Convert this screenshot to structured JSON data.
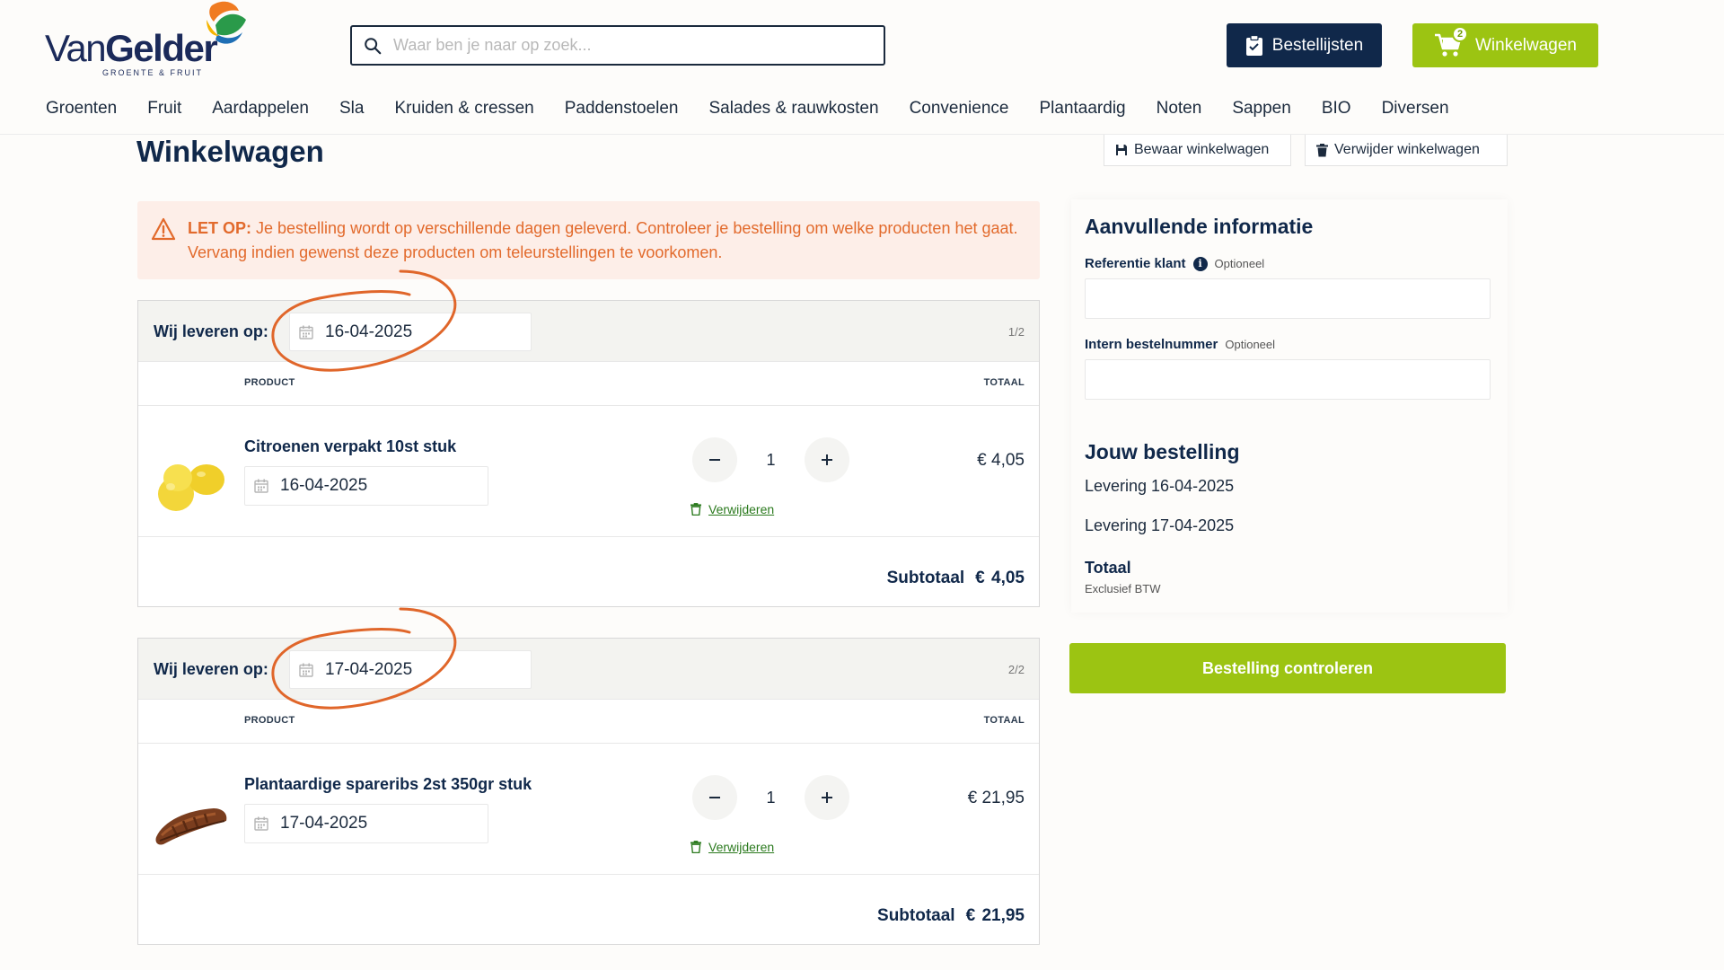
{
  "brand": {
    "name_light": "Van",
    "name_bold": "Gelder",
    "tagline": "GROENTE & FRUIT"
  },
  "search": {
    "placeholder": "Waar ben je naar op zoek..."
  },
  "header": {
    "lists_label": "Bestellijsten",
    "cart_label": "Winkelwagen",
    "cart_count": "2",
    "accent_green": "#9cc412",
    "accent_navy": "#10284a"
  },
  "nav": [
    "Groenten",
    "Fruit",
    "Aardappelen",
    "Sla",
    "Kruiden & cressen",
    "Paddenstoelen",
    "Salades & rauwkosten",
    "Convenience",
    "Plantaardig",
    "Noten",
    "Sappen",
    "BIO",
    "Diversen"
  ],
  "page": {
    "title": "Winkelwagen",
    "save_label": "Bewaar winkelwagen",
    "delete_label": "Verwijder winkelwagen"
  },
  "warning": {
    "lead": "LET OP:",
    "text": " Je bestelling wordt op verschillende dagen geleverd. Controleer je bestelling om welke producten het gaat. Vervang indien gewenst deze producten om teleurstellingen te voorkomen.",
    "color": "#e26a2c"
  },
  "deliveries": [
    {
      "label": "Wij leveren op:",
      "date": "16-04-2025",
      "page": "1/2",
      "col_product": "PRODUCT",
      "col_total": "TOTAAL",
      "product": {
        "name": "Citroenen verpakt 10st stuk",
        "date": "16-04-2025",
        "qty": "1",
        "price": "€ 4,05",
        "remove": "Verwijderen",
        "image": "lemons"
      },
      "subtotal_label": "Subtotaal",
      "subtotal_value": "€ 4,05"
    },
    {
      "label": "Wij leveren op:",
      "date": "17-04-2025",
      "page": "2/2",
      "col_product": "PRODUCT",
      "col_total": "TOTAAL",
      "product": {
        "name": "Plantaardige spareribs 2st 350gr stuk",
        "date": "17-04-2025",
        "qty": "1",
        "price": "€ 21,95",
        "remove": "Verwijderen",
        "image": "spareribs"
      },
      "subtotal_label": "Subtotaal",
      "subtotal_value": "€ 21,95"
    }
  ],
  "sidebar": {
    "info_title": "Aanvullende informatie",
    "ref_label": "Referentie klant",
    "ref_optional": "Optioneel",
    "intern_label": "Intern bestelnummer",
    "intern_optional": "Optioneel",
    "ref_value": "",
    "intern_value": "",
    "order_title": "Jouw bestelling",
    "lines": [
      "Levering 16-04-2025",
      "Levering 17-04-2025"
    ],
    "total_label": "Totaal",
    "total_note": "Exclusief BTW"
  },
  "checkout": {
    "label": "Bestelling controleren"
  },
  "annotation_color": "#e0662a"
}
